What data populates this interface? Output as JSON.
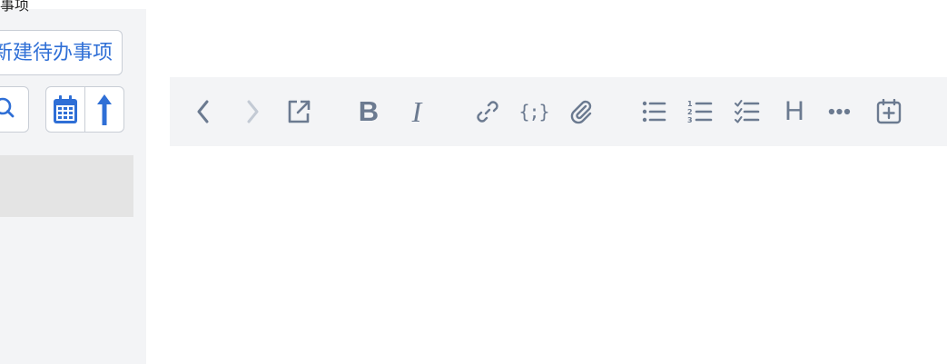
{
  "sidebar": {
    "top_cut_label": "事项",
    "create_button_label": "新建待办事项"
  },
  "toolbar": {
    "bold_label": "B",
    "italic_label": "I",
    "code_label": "{;}",
    "heading_label": "H"
  },
  "colors": {
    "accent_blue": "#2f6fd6",
    "toolbar_icon": "#6b7a90",
    "toolbar_icon_disabled": "#c3cad4",
    "panel_bg": "#f3f4f6"
  }
}
